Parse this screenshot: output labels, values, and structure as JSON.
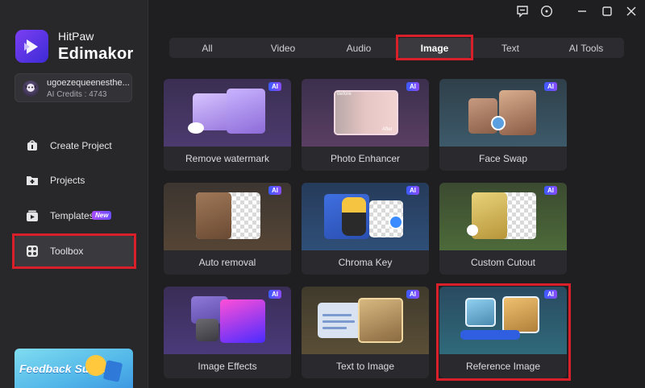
{
  "app": {
    "brand_top": "HitPaw",
    "brand_bottom": "Edimakor"
  },
  "account": {
    "name": "ugoezequeenesthe...",
    "credits": "AI Credits : 4743"
  },
  "nav": [
    {
      "label": "Create Project",
      "icon": "create-project-icon"
    },
    {
      "label": "Projects",
      "icon": "projects-folder-icon"
    },
    {
      "label": "Templates",
      "icon": "templates-icon",
      "badge": "New"
    },
    {
      "label": "Toolbox",
      "icon": "toolbox-icon"
    }
  ],
  "feedback": {
    "text": "Feedback Survey"
  },
  "tabs": [
    {
      "label": "All"
    },
    {
      "label": "Video"
    },
    {
      "label": "Audio"
    },
    {
      "label": "Image",
      "active": true
    },
    {
      "label": "Text"
    },
    {
      "label": "AI Tools"
    }
  ],
  "cards": [
    {
      "label": "Remove watermark",
      "badge": "AI"
    },
    {
      "label": "Photo Enhancer",
      "badge": "AI",
      "before": "Before",
      "after": "After"
    },
    {
      "label": "Face Swap",
      "badge": "AI"
    },
    {
      "label": "Auto removal",
      "badge": "AI"
    },
    {
      "label": "Chroma Key",
      "badge": "AI"
    },
    {
      "label": "Custom Cutout",
      "badge": "AI"
    },
    {
      "label": "Image Effects",
      "badge": "AI"
    },
    {
      "label": "Text to Image",
      "badge": "AI"
    },
    {
      "label": "Reference Image",
      "badge": "AI"
    }
  ],
  "colors": {
    "accent": "#7b3ff2",
    "highlight": "#d9202a",
    "background": "#1f1f21"
  }
}
